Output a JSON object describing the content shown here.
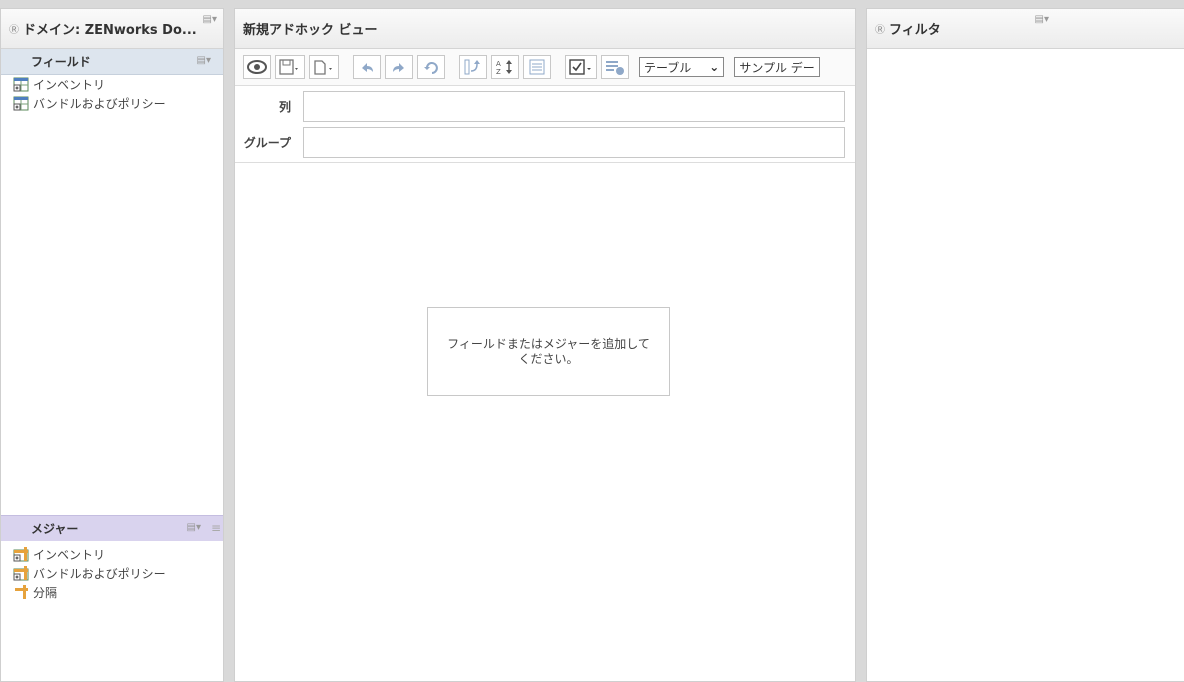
{
  "left_panel": {
    "title": "ドメイン: ZENworks Do...",
    "fields_header": "フィールド",
    "fields": [
      {
        "label": "インベントリ"
      },
      {
        "label": "バンドルおよびポリシー"
      }
    ],
    "measures_header": "メジャー",
    "measures": [
      {
        "label": "インベントリ"
      },
      {
        "label": "バンドルおよびポリシー"
      },
      {
        "label": "分隔"
      }
    ]
  },
  "center_panel": {
    "title": "新規アドホック ビュー",
    "view_type_select": "テーブル",
    "data_select": "サンプル デー",
    "columns_label": "列",
    "groups_label": "グループ",
    "hint": "フィールドまたはメジャーを追加してください。"
  },
  "right_panel": {
    "title": "フィルタ"
  },
  "colors": {
    "fields_bar": "#dde5ee",
    "measures_bar": "#d9d3ee",
    "background": "#d9d9d9"
  }
}
